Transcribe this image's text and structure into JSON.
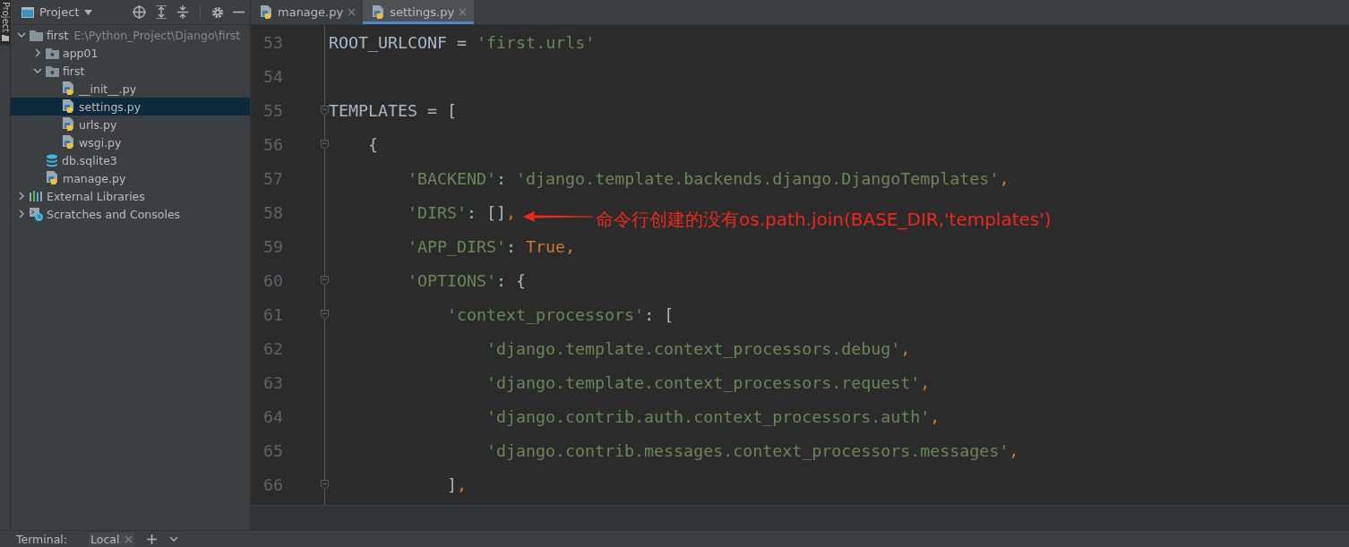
{
  "tool_strip": {
    "label": "Project",
    "selected": true
  },
  "project_panel": {
    "title": "Project",
    "tree": [
      {
        "label": "first",
        "hint": "E:\\Python_Project\\Django\\first",
        "kind": "folder",
        "expanded": true,
        "selected": false,
        "children": [
          {
            "label": "app01",
            "kind": "package",
            "expanded": false,
            "selected": false
          },
          {
            "label": "first",
            "kind": "package",
            "expanded": true,
            "selected": false,
            "children": [
              {
                "label": "__init__.py",
                "kind": "python",
                "selected": false
              },
              {
                "label": "settings.py",
                "kind": "python",
                "selected": true
              },
              {
                "label": "urls.py",
                "kind": "python",
                "selected": false
              },
              {
                "label": "wsgi.py",
                "kind": "python",
                "selected": false
              }
            ]
          },
          {
            "label": "db.sqlite3",
            "kind": "database",
            "selected": false
          },
          {
            "label": "manage.py",
            "kind": "python",
            "selected": false
          }
        ]
      },
      {
        "label": "External Libraries",
        "kind": "library",
        "expanded": false,
        "selected": false
      },
      {
        "label": "Scratches and Consoles",
        "kind": "scratches",
        "expanded": false,
        "selected": false
      }
    ]
  },
  "editor_tabs": [
    {
      "label": "manage.py",
      "selected": false
    },
    {
      "label": "settings.py",
      "selected": true
    }
  ],
  "code_lines": [
    {
      "number": "53",
      "fold": false,
      "tokens": [
        {
          "kind": "plain",
          "text": "ROOT_URLCONF = "
        },
        {
          "kind": "string",
          "text": "'first.urls'"
        }
      ]
    },
    {
      "number": "54",
      "fold": false
    },
    {
      "number": "55",
      "fold": true,
      "tokens": [
        {
          "kind": "plain",
          "text": "TEMPLATES = ["
        }
      ],
      "children": [
        {
          "number": "56",
          "fold": true,
          "tokens": [
            {
              "kind": "plain",
              "text": "{"
            }
          ],
          "children": [
            {
              "number": "57",
              "fold": false,
              "tokens": [
                {
                  "kind": "string",
                  "text": "'BACKEND'"
                },
                {
                  "kind": "plain",
                  "text": ": "
                },
                {
                  "kind": "string",
                  "text": "'django.template.backends.django.DjangoTemplates'"
                },
                {
                  "kind": "punct",
                  "text": ","
                }
              ]
            },
            {
              "number": "58",
              "fold": false,
              "tokens": [
                {
                  "kind": "string",
                  "text": "'DIRS'"
                },
                {
                  "kind": "plain",
                  "text": ": []"
                },
                {
                  "kind": "punct",
                  "text": ","
                }
              ],
              "note": "命令行创建的没有os.path.join(BASE_DIR,'templates')"
            },
            {
              "number": "59",
              "fold": false,
              "tokens": [
                {
                  "kind": "string",
                  "text": "'APP_DIRS'"
                },
                {
                  "kind": "plain",
                  "text": ": "
                },
                {
                  "kind": "keyword",
                  "text": "True"
                },
                {
                  "kind": "punct",
                  "text": ","
                }
              ]
            },
            {
              "number": "60",
              "fold": true,
              "tokens": [
                {
                  "kind": "string",
                  "text": "'OPTIONS'"
                },
                {
                  "kind": "plain",
                  "text": ": {"
                }
              ],
              "children": [
                {
                  "number": "61",
                  "fold": true,
                  "tokens": [
                    {
                      "kind": "string",
                      "text": "'context_processors'"
                    },
                    {
                      "kind": "plain",
                      "text": ": ["
                    }
                  ],
                  "children": [
                    {
                      "number": "62",
                      "fold": false,
                      "tokens": [
                        {
                          "kind": "string",
                          "text": "'django.template.context_processors.debug'"
                        },
                        {
                          "kind": "punct",
                          "text": ","
                        }
                      ]
                    },
                    {
                      "number": "63",
                      "fold": false,
                      "tokens": [
                        {
                          "kind": "string",
                          "text": "'django.template.context_processors.request'"
                        },
                        {
                          "kind": "punct",
                          "text": ","
                        }
                      ]
                    },
                    {
                      "number": "64",
                      "fold": false,
                      "tokens": [
                        {
                          "kind": "string",
                          "text": "'django.contrib.auth.context_processors.auth'"
                        },
                        {
                          "kind": "punct",
                          "text": ","
                        }
                      ]
                    },
                    {
                      "number": "65",
                      "fold": false,
                      "tokens": [
                        {
                          "kind": "string",
                          "text": "'django.contrib.messages.context_processors.messages'"
                        },
                        {
                          "kind": "punct",
                          "text": ","
                        }
                      ]
                    }
                  ]
                },
                {
                  "number": "66",
                  "fold": true,
                  "tokens": [
                    {
                      "kind": "plain",
                      "text": "]"
                    },
                    {
                      "kind": "punct",
                      "text": ","
                    }
                  ]
                }
              ]
            }
          ]
        }
      ]
    }
  ],
  "bottom_bar": {
    "label": "Terminal:",
    "tabs": [
      {
        "label": "Local",
        "selected": true
      }
    ]
  }
}
